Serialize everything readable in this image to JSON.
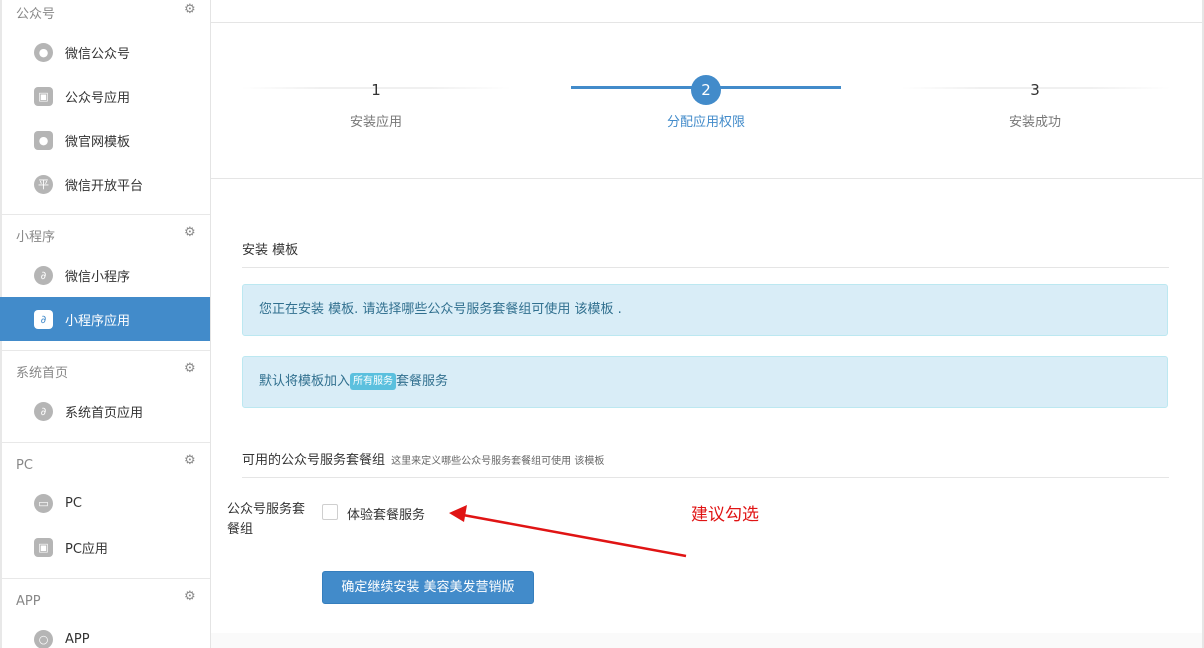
{
  "sidebar": {
    "sections": [
      {
        "title": "公众号",
        "items": [
          {
            "label": "微信公众号",
            "icon": "wechat-icon"
          },
          {
            "label": "公众号应用",
            "icon": "store-icon"
          },
          {
            "label": "微官网模板",
            "icon": "wechat-icon"
          },
          {
            "label": "微信开放平台",
            "icon": "platform-icon",
            "glyph": "平"
          }
        ]
      },
      {
        "title": "小程序",
        "items": [
          {
            "label": "微信小程序",
            "icon": "miniprogram-icon"
          },
          {
            "label": "小程序应用",
            "icon": "store-icon",
            "active": true
          }
        ]
      },
      {
        "title": "系统首页",
        "items": [
          {
            "label": "系统首页应用",
            "icon": "miniprogram-icon"
          }
        ]
      },
      {
        "title": "PC",
        "items": [
          {
            "label": "PC",
            "icon": "monitor-icon"
          },
          {
            "label": "PC应用",
            "icon": "store-icon"
          }
        ]
      },
      {
        "title": "APP",
        "items": [
          {
            "label": "APP",
            "icon": "app-icon"
          }
        ]
      }
    ]
  },
  "stepper": {
    "steps": [
      {
        "number": "1",
        "label": "安装应用"
      },
      {
        "number": "2",
        "label": "分配应用权限",
        "active": true
      },
      {
        "number": "3",
        "label": "安装成功"
      }
    ]
  },
  "content": {
    "section_title": "安装 模板",
    "alert_info": "您正在安装 模板. 请选择哪些公众号服务套餐组可使用 该模板 .",
    "alert_default_prefix": "默认将模板加入",
    "alert_default_badge": "所有服务",
    "alert_default_suffix": "套餐服务",
    "groups_title": "可用的公众号服务套餐组",
    "groups_hint": "这里来定义哪些公众号服务套餐组可使用 该模板",
    "form_label": "公众号服务套餐组",
    "checkbox_label": "体验套餐服务",
    "checkbox_checked": false,
    "submit_button": "确定继续安装 美容美发营销版"
  },
  "annotation": {
    "text": "建议勾选",
    "color": "#e01414"
  },
  "colors": {
    "primary": "#428bca",
    "alert_bg": "#d9edf7",
    "alert_text": "#31708f",
    "badge": "#5bc0de"
  }
}
